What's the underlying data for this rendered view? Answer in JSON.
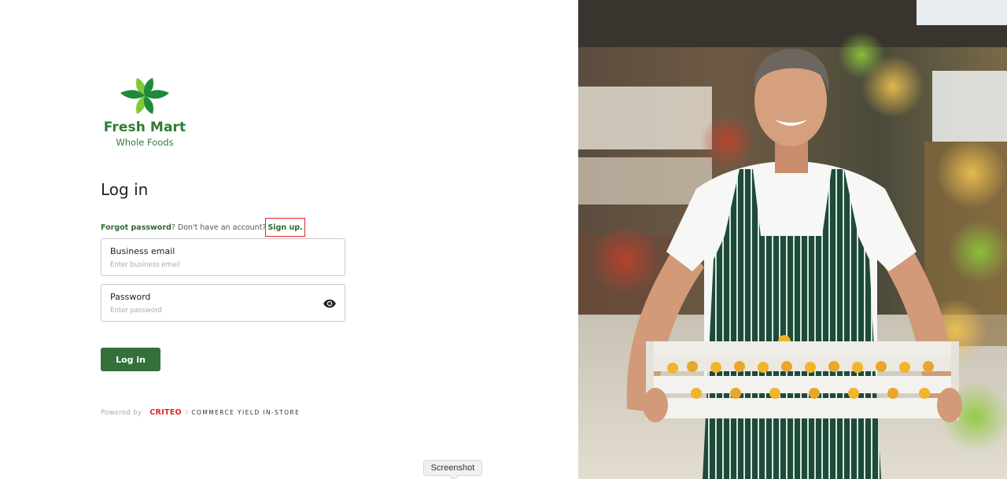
{
  "brand": {
    "name": "Fresh Mart",
    "tagline": "Whole Foods",
    "logo_icon": "leaf-flower-icon",
    "colors": {
      "primary": "#2e7d32",
      "leaf_light": "#7ccb3a",
      "leaf_dark": "#1e8a3a"
    }
  },
  "login": {
    "heading": "Log in",
    "forgot_password": "Forgot password",
    "forgot_suffix": "?",
    "no_account": " Don't have an account?",
    "sign_up": "Sign up.",
    "email": {
      "label": "Business email",
      "placeholder": "Enter business email",
      "value": ""
    },
    "password": {
      "label": "Password",
      "placeholder": "Enter password",
      "value": "",
      "toggle_icon": "eye-icon"
    },
    "submit": "Log in",
    "button_color": "#33703a"
  },
  "footer": {
    "powered_by": "Powered by",
    "criteo": "CRITEO",
    "separator": "//",
    "product": "COMMERCE YIELD IN-STORE"
  },
  "tooltip": {
    "text": "Screenshot"
  }
}
